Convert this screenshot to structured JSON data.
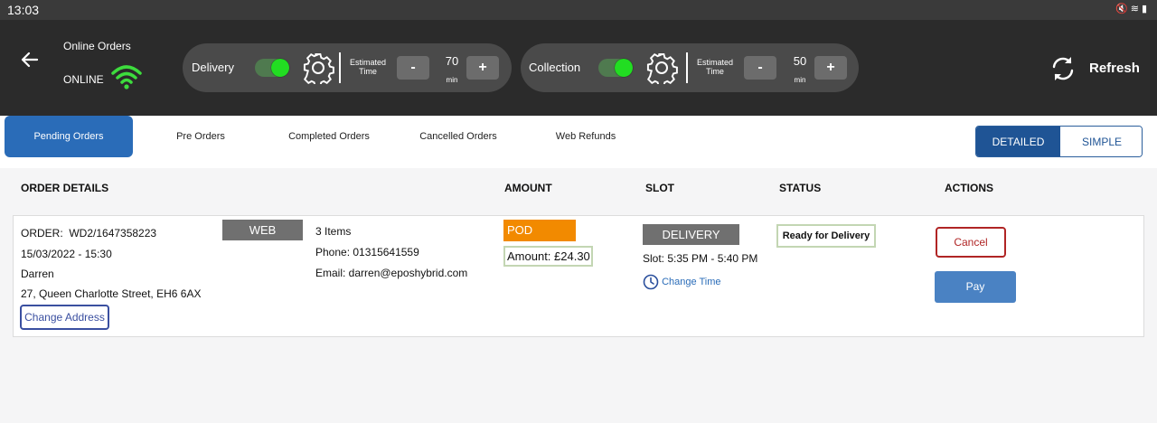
{
  "statusbar": {
    "time": "13:03",
    "icons": [
      "mute-icon",
      "wifi-icon",
      "battery-icon"
    ]
  },
  "header": {
    "title": "Online Orders",
    "status": "ONLINE",
    "delivery": {
      "label": "Delivery",
      "enabled": true,
      "est_label_1": "Estimated",
      "est_label_2": "Time",
      "minus": "-",
      "plus": "+",
      "value": "70",
      "unit": "min"
    },
    "collection": {
      "label": "Collection",
      "enabled": true,
      "est_label_1": "Estimated",
      "est_label_2": "Time",
      "minus": "-",
      "plus": "+",
      "value": "50",
      "unit": "min"
    },
    "refresh_label": "Refresh"
  },
  "tabs": [
    {
      "label": "Pending Orders",
      "active": true
    },
    {
      "label": "Pre Orders",
      "active": false
    },
    {
      "label": "Completed Orders",
      "active": false
    },
    {
      "label": "Cancelled Orders",
      "active": false
    },
    {
      "label": "Web Refunds",
      "active": false
    }
  ],
  "view_toggle": {
    "detailed": "DETAILED",
    "simple": "SIMPLE",
    "selected": "DETAILED"
  },
  "columns": {
    "order_details": "ORDER DETAILS",
    "amount": "AMOUNT",
    "slot": "SLOT",
    "status": "STATUS",
    "actions": "ACTIONS"
  },
  "order": {
    "order_label": "ORDER:",
    "order_id": "WD2/1647358223",
    "datetime": "15/03/2022 - 15:30",
    "customer": "Darren",
    "address": "27, Queen Charlotte Street, EH6 6AX",
    "change_address": "Change Address",
    "source": "WEB",
    "items": "3 Items",
    "phone": "Phone: 01315641559",
    "email": "Email: darren@eposhybrid.com",
    "payment": "POD",
    "amount": "Amount:  £24.30",
    "slot_type": "DELIVERY",
    "slot_time": "Slot: 5:35 PM - 5:40 PM",
    "change_time": "Change Time",
    "status": "Ready for Delivery",
    "cancel": "Cancel",
    "pay": "Pay"
  },
  "colors": {
    "header_bg": "#2b2b2b",
    "accent": "#2a6cb8",
    "toggle_on": "#22dd22",
    "pod": "#f28a00",
    "cancel": "#b02525"
  }
}
